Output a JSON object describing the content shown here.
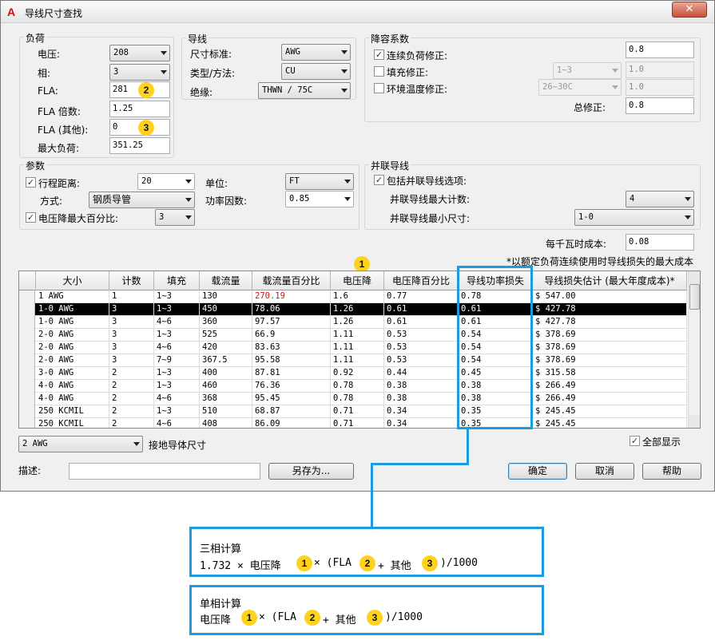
{
  "window": {
    "title": "导线尺寸查找",
    "close_glyph": "✕"
  },
  "load": {
    "group_label": "负荷",
    "voltage_label": "电压:",
    "voltage_value": "208",
    "phase_label": "相:",
    "phase_value": "3",
    "fla_label": "FLA:",
    "fla_value": "281",
    "fla_mult_label": "FLA 倍数:",
    "fla_mult_value": "1.25",
    "fla_other_label": "FLA (其他):",
    "fla_other_value": "0",
    "max_load_label": "最大负荷:",
    "max_load_value": "351.25"
  },
  "wire": {
    "group_label": "导线",
    "size_std_label": "尺寸标准:",
    "size_std_value": "AWG",
    "type_label": "类型/方法:",
    "type_value": "CU",
    "insulation_label": "绝缘:",
    "insulation_value": "THWN / 75C"
  },
  "derate": {
    "group_label": "降容系数",
    "continuous_label": "连续负荷修正:",
    "continuous_checked": true,
    "continuous_value": "0.8",
    "fill_label": "填充修正:",
    "fill_checked": false,
    "fill_select": "1~3",
    "fill_value": "1.0",
    "temp_label": "环境温度修正:",
    "temp_checked": false,
    "temp_select": "26~30C",
    "temp_value": "1.0",
    "total_label": "总修正:",
    "total_value": "0.8"
  },
  "params": {
    "group_label": "参数",
    "distance_label": "行程距离:",
    "distance_checked": true,
    "distance_value": "20",
    "method_label": "方式:",
    "method_value": "钢质导管",
    "vdrop_label": "电压降最大百分比:",
    "vdrop_checked": true,
    "vdrop_value": "3",
    "unit_label": "单位:",
    "unit_value": "FT",
    "pf_label": "功率因数:",
    "pf_value": "0.85"
  },
  "parallel": {
    "group_label": "并联导线",
    "include_label": "包括并联导线选项:",
    "include_checked": true,
    "max_count_label": "并联导线最大计数:",
    "max_count_value": "4",
    "min_size_label": "并联导线最小尺寸:",
    "min_size_value": "1-0"
  },
  "cost": {
    "label": "每千瓦时成本:",
    "value": "0.08",
    "note": "*以额定负荷连续使用时导线损失的最大成本"
  },
  "table": {
    "headers": [
      "大小",
      "计数",
      "填充",
      "载流量",
      "载流量百分比",
      "电压降",
      "电压降百分比",
      "导线功率损失",
      "导线损失估计 (最大年度成本)*"
    ],
    "rows": [
      {
        "size": "1 AWG",
        "count": "1",
        "fill": "1~3",
        "amp": "130",
        "amp_pct": "270.19",
        "vd": "1.6",
        "vd_pct": "0.77",
        "loss": "0.78",
        "cost": "$ 547.00",
        "selected": false,
        "amp_pct_red": true
      },
      {
        "size": "1-0 AWG",
        "count": "3",
        "fill": "1~3",
        "amp": "450",
        "amp_pct": "78.06",
        "vd": "1.26",
        "vd_pct": "0.61",
        "loss": "0.61",
        "cost": "$ 427.78",
        "selected": true,
        "amp_pct_red": false
      },
      {
        "size": "1-0 AWG",
        "count": "3",
        "fill": "4~6",
        "amp": "360",
        "amp_pct": "97.57",
        "vd": "1.26",
        "vd_pct": "0.61",
        "loss": "0.61",
        "cost": "$ 427.78",
        "selected": false,
        "amp_pct_red": false
      },
      {
        "size": "2-0 AWG",
        "count": "3",
        "fill": "1~3",
        "amp": "525",
        "amp_pct": "66.9",
        "vd": "1.11",
        "vd_pct": "0.53",
        "loss": "0.54",
        "cost": "$ 378.69",
        "selected": false,
        "amp_pct_red": false
      },
      {
        "size": "2-0 AWG",
        "count": "3",
        "fill": "4~6",
        "amp": "420",
        "amp_pct": "83.63",
        "vd": "1.11",
        "vd_pct": "0.53",
        "loss": "0.54",
        "cost": "$ 378.69",
        "selected": false,
        "amp_pct_red": false
      },
      {
        "size": "2-0 AWG",
        "count": "3",
        "fill": "7~9",
        "amp": "367.5",
        "amp_pct": "95.58",
        "vd": "1.11",
        "vd_pct": "0.53",
        "loss": "0.54",
        "cost": "$ 378.69",
        "selected": false,
        "amp_pct_red": false
      },
      {
        "size": "3-0 AWG",
        "count": "2",
        "fill": "1~3",
        "amp": "400",
        "amp_pct": "87.81",
        "vd": "0.92",
        "vd_pct": "0.44",
        "loss": "0.45",
        "cost": "$ 315.58",
        "selected": false,
        "amp_pct_red": false
      },
      {
        "size": "4-0 AWG",
        "count": "2",
        "fill": "1~3",
        "amp": "460",
        "amp_pct": "76.36",
        "vd": "0.78",
        "vd_pct": "0.38",
        "loss": "0.38",
        "cost": "$ 266.49",
        "selected": false,
        "amp_pct_red": false
      },
      {
        "size": "4-0 AWG",
        "count": "2",
        "fill": "4~6",
        "amp": "368",
        "amp_pct": "95.45",
        "vd": "0.78",
        "vd_pct": "0.38",
        "loss": "0.38",
        "cost": "$ 266.49",
        "selected": false,
        "amp_pct_red": false
      },
      {
        "size": "250 KCMIL",
        "count": "2",
        "fill": "1~3",
        "amp": "510",
        "amp_pct": "68.87",
        "vd": "0.71",
        "vd_pct": "0.34",
        "loss": "0.35",
        "cost": "$ 245.45",
        "selected": false,
        "amp_pct_red": false
      },
      {
        "size": "250 KCMIL",
        "count": "2",
        "fill": "4~6",
        "amp": "408",
        "amp_pct": "86.09",
        "vd": "0.71",
        "vd_pct": "0.34",
        "loss": "0.35",
        "cost": "$ 245.45",
        "selected": false,
        "amp_pct_red": false
      }
    ]
  },
  "ground": {
    "value": "2 AWG",
    "label": "接地导体尺寸"
  },
  "show_all": {
    "label": "全部显示",
    "checked": true
  },
  "footer": {
    "desc_label": "描述:",
    "desc_value": "",
    "save_as": "另存为...",
    "ok": "确定",
    "cancel": "取消",
    "help": "帮助"
  },
  "badges": {
    "one": "1",
    "two": "2",
    "three": "3"
  },
  "formulas": {
    "three_phase": {
      "title": "三相计算",
      "p1": "1.732 × 电压降",
      "p2": "× (FLA",
      "p3": "+ 其他",
      "p4": ")/1000"
    },
    "single_phase": {
      "title": "单相计算",
      "p1": "电压降",
      "p2": "× (FLA",
      "p3": "+ 其他",
      "p4": ")/1000"
    }
  },
  "accent_color": "#1e9be0",
  "badge_color": "#ffd21e"
}
